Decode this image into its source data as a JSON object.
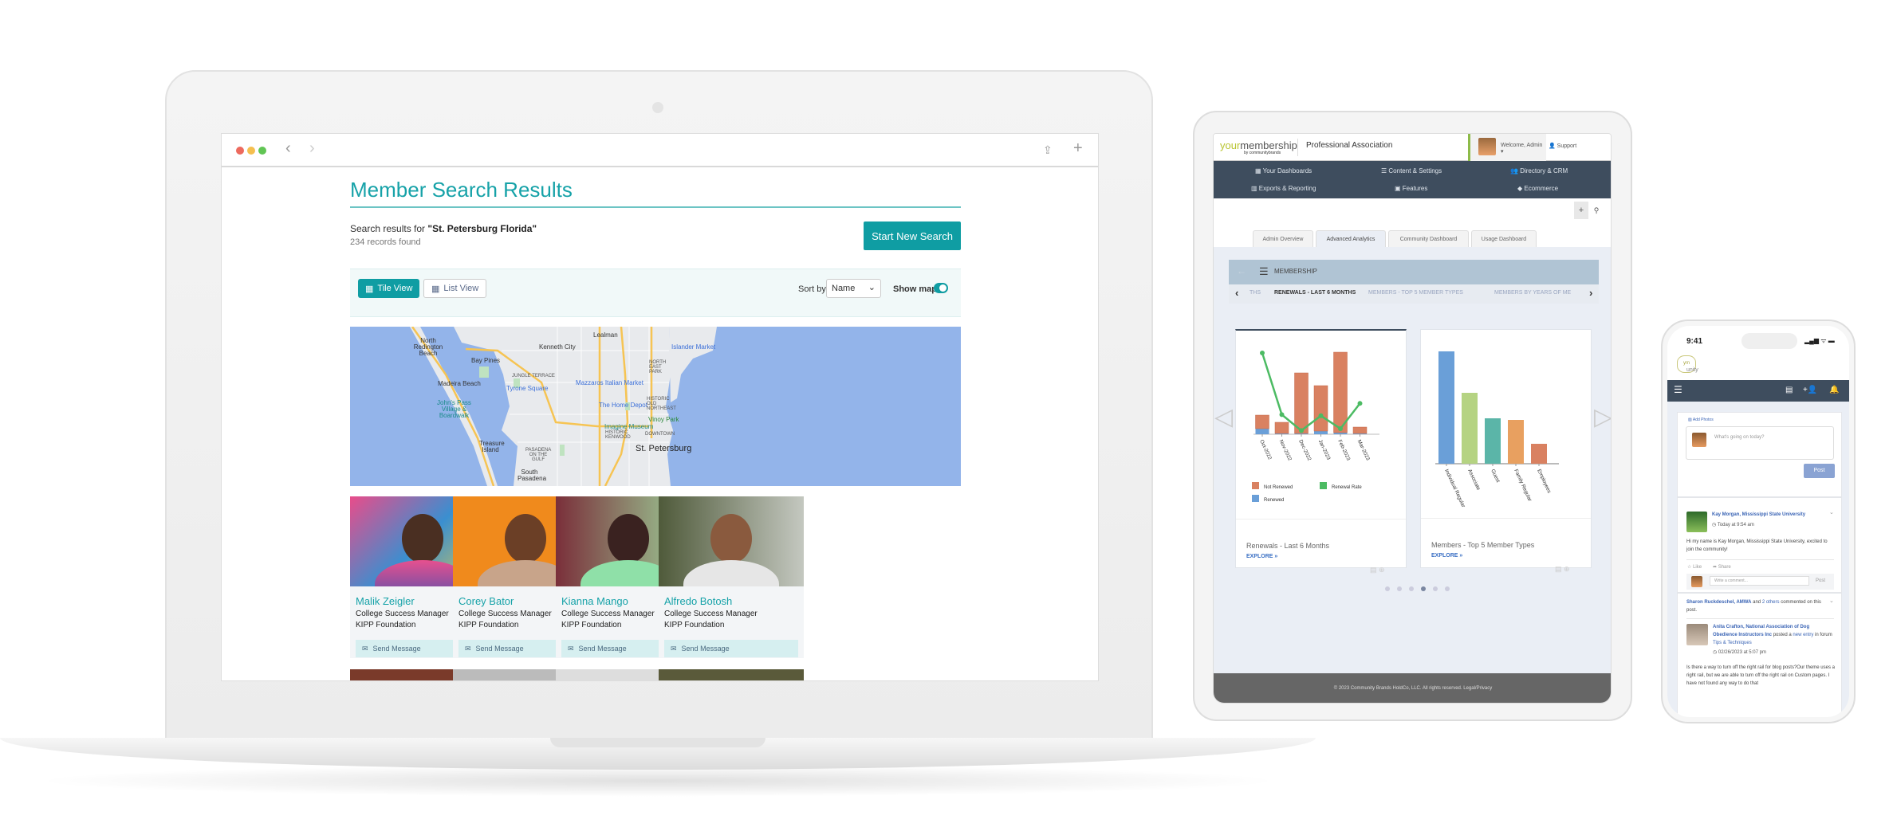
{
  "laptop": {
    "browser": {
      "back_icon": "chevron-left-icon",
      "forward_icon": "chevron-right-icon",
      "share_icon": "share-icon",
      "new_tab_icon": "plus-icon"
    },
    "title": "Member Search Results",
    "search_prefix": "Search results for ",
    "search_query": "\"St. Petersburg Florida\"",
    "records": "234 records found",
    "start_new_search": "Start New Search",
    "tile_view": "Tile View",
    "list_view": "List View",
    "sort_label": "Sort by:",
    "sort_value": "Name",
    "show_map": "Show map",
    "show_map_on": true,
    "map_labels": {
      "north_redington": "North Redington Beach",
      "bay_pines": "Bay Pines",
      "kenneth_city": "Kenneth City",
      "lealman": "Lealman",
      "islander_market": "Islander Market",
      "madeira": "Madeira Beach",
      "jungle_terrace": "JUNGLE TERRACE",
      "tyrone": "Tyrone Square",
      "mazzaros": "Mazzaros Italian Market",
      "johns_pass": "John's Pass Village & Boardwalk",
      "home_depot": "The Home Depot",
      "north_east_park": "NORTH EAST PARK",
      "old_northeast": "HISTORIC OLD NORTHEAST",
      "vinoy": "Vinoy Park",
      "imagine": "Imagine Museum",
      "kenwood": "HISTORIC KENWOOD",
      "downtown": "DOWNTOWN",
      "st_pete": "St. Petersburg",
      "treasure": "Treasure Island",
      "pasadena_gulf": "PASADENA ON THE GULF",
      "south_pasadena": "South Pasadena"
    },
    "members": [
      {
        "name": "Malik Zeigler",
        "role": "College Success Manager",
        "org": "KIPP Foundation",
        "action": "Send Message"
      },
      {
        "name": "Corey Bator",
        "role": "College Success Manager",
        "org": "KIPP Foundation",
        "action": "Send Message"
      },
      {
        "name": "Kianna Mango",
        "role": "College Success Manager",
        "org": "KIPP Foundation",
        "action": "Send Message"
      },
      {
        "name": "Alfredo Botosh",
        "role": "College Success Manager",
        "org": "KIPP Foundation",
        "action": "Send Message"
      }
    ]
  },
  "tablet": {
    "logo": "yourmembership",
    "logo_y": "your",
    "logo_rest": "membership",
    "logo_sub": "by communitybrands",
    "org_name": "Professional Association",
    "welcome": "Welcome, Admin ▾",
    "support": "Support",
    "nav": [
      "Your Dashboards",
      "Content & Settings",
      "Directory & CRM",
      "Exports & Reporting",
      "Features",
      "Ecommerce"
    ],
    "tabs": [
      "Admin Overview",
      "Advanced Analytics",
      "Community Dashboard",
      "Usage Dashboard"
    ],
    "active_tab": "Advanced Analytics",
    "section": "MEMBERSHIP",
    "subtabs": [
      "THS",
      "RENEWALS - LAST 6 MONTHS",
      "MEMBERS - TOP 5 MEMBER TYPES",
      "MEMBERS BY YEARS OF ME"
    ],
    "cards": [
      {
        "title": "Renewals - Last 6 Months",
        "explore": "EXPLORE »"
      },
      {
        "title": "Members - Top 5 Member Types",
        "explore": "EXPLORE »"
      }
    ],
    "carousel_active": 4,
    "carousel_count": 6,
    "footer": "© 2023 Community Brands HoldCo, LLC. All rights reserved. Legal/Privacy"
  },
  "chart_data": [
    {
      "type": "bar",
      "stacked": true,
      "categories": [
        "Oct-2022",
        "Nov-2022",
        "Dec-2022",
        "Jan-2023",
        "Feb-2023",
        "Mar-2023"
      ],
      "series": [
        {
          "name": "Not Renewed",
          "values": [
            17,
            14,
            76,
            57,
            101,
            8
          ],
          "color": "#d98161"
        },
        {
          "name": "Renewed",
          "values": [
            7,
            1,
            1,
            4,
            2,
            1
          ],
          "color": "#6a9fd8"
        },
        {
          "name": "Renewal Rate",
          "type": "line",
          "values": [
            29,
            7,
            1.3,
            6.6,
            2,
            11
          ],
          "color": "#4cbb63"
        }
      ],
      "legend": "bottom"
    },
    {
      "type": "bar",
      "categories": [
        "Individual Regular",
        "Associate",
        "Guest",
        "Family Regular",
        "Employees"
      ],
      "values": [
        141,
        89,
        57,
        55,
        25
      ],
      "colors": [
        "#6a9fd8",
        "#b5d382",
        "#5bb5a8",
        "#e8a060",
        "#d98161"
      ]
    }
  ],
  "phone": {
    "time": "9:41",
    "status": "▂▄▆ ᯤ ▬",
    "logo_ym": "ym",
    "logo_text": "unity",
    "add_photos": "Add Photos",
    "composer_placeholder": "What's going on today?",
    "post_button": "Post",
    "post1": {
      "author": "Kay Morgan, Mississippi State University",
      "time": "Today at 9:54 am",
      "body": "Hi my name is Kay Morgan, Mississippi State University, excited to join the community!",
      "like": "Like",
      "share": "Share",
      "comment_placeholder": "Write a comment...",
      "comment_post": "Post"
    },
    "post2": {
      "commenter": "Sharon Ruckdeschel, AMWA",
      "and": " and ",
      "others": "2 others",
      "commented": "commented on this post.",
      "author": "Anita Crafton, National Association of Dog Obedience Instructors Inc",
      "posted": " posted a ",
      "new_entry": "new entry",
      "in_forum": " in forum ",
      "forum": "Tips & Techniques",
      "time": "02/26/2023 at 5:07 pm",
      "body": "Is there a way to turn off the right rail for blog posts?Our theme uses a right rail, but we are able to turn off the right rail on Custom pages. I have not found any way to do that"
    }
  }
}
